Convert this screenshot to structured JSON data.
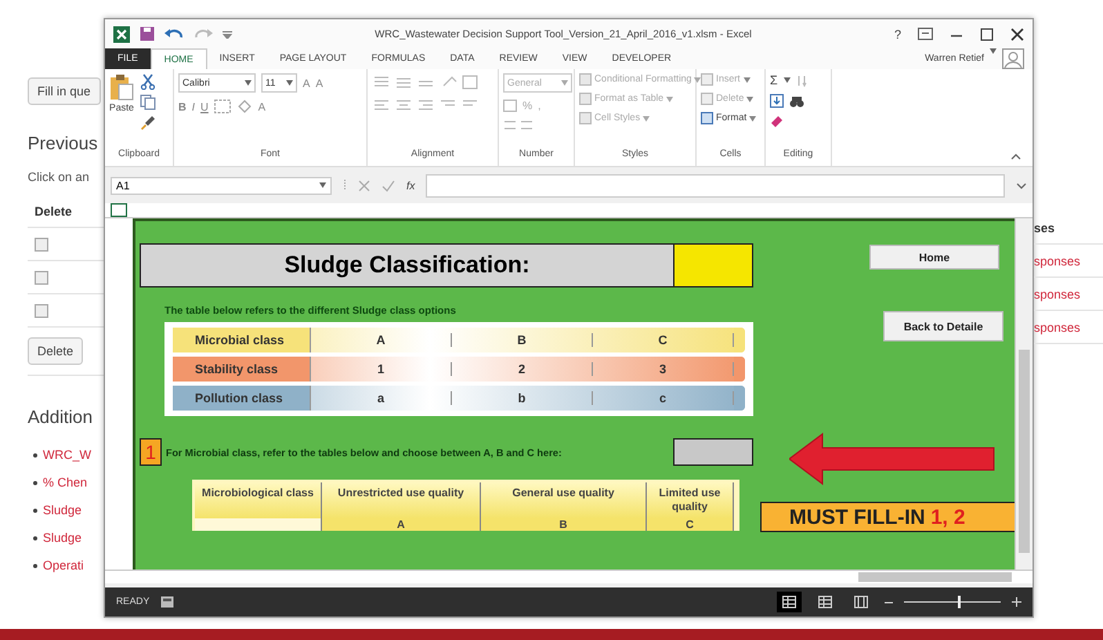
{
  "background_page": {
    "left": {
      "button": "Fill in que",
      "heading": "Previous",
      "instruction": "Click on an",
      "table_header": "Delete",
      "checkboxes": [
        {
          "checked": false
        },
        {
          "checked": false
        },
        {
          "checked": false
        }
      ],
      "delete_button": "Delete",
      "heading_2": "Addition",
      "links": [
        "WRC_W",
        "% Chen",
        "Sludge",
        "Sludge",
        "Operati"
      ]
    },
    "right": {
      "header": "ses",
      "links": [
        "sponses",
        "sponses",
        "sponses"
      ]
    }
  },
  "window": {
    "title": "WRC_Wastewater Decision Support Tool_Version_21_April_2016_v1.xlsm - Excel",
    "help": "?",
    "user": "Warren Retief"
  },
  "ribbon_tabs": [
    {
      "label": "FILE",
      "kind": "file",
      "selected": false
    },
    {
      "label": "HOME",
      "kind": "tab",
      "selected": true
    },
    {
      "label": "INSERT",
      "kind": "tab",
      "selected": false
    },
    {
      "label": "PAGE LAYOUT",
      "kind": "tab",
      "selected": false
    },
    {
      "label": "FORMULAS",
      "kind": "tab",
      "selected": false
    },
    {
      "label": "DATA",
      "kind": "tab",
      "selected": false
    },
    {
      "label": "REVIEW",
      "kind": "tab",
      "selected": false
    },
    {
      "label": "VIEW",
      "kind": "tab",
      "selected": false
    },
    {
      "label": "DEVELOPER",
      "kind": "tab",
      "selected": false
    }
  ],
  "ribbon": {
    "paste": "Paste",
    "font_name": "Calibri",
    "font_size": "11",
    "grow_buttons": [
      "A",
      "A"
    ],
    "format_buttons": [
      "B",
      "I",
      "U"
    ],
    "font_color": "A",
    "number_format": "General",
    "number_buttons": [
      "%",
      ","
    ],
    "styles": [
      "Conditional Formatting",
      "Format as Table",
      "Cell Styles"
    ],
    "cells": [
      "Insert",
      "Delete",
      "Format"
    ],
    "sum": "Σ",
    "groups": [
      "Clipboard",
      "Font",
      "Alignment",
      "Number",
      "Styles",
      "Cells",
      "Editing"
    ]
  },
  "formula_bar": {
    "name_box": "A1",
    "function_label": "fx"
  },
  "sheet": {
    "title": "Sludge Classification:",
    "subtitle": "The table below refers to the different Sludge class options",
    "class_rows": [
      {
        "label": "Microbial class",
        "values": [
          "A",
          "B",
          "C"
        ],
        "color": "#f6e27a"
      },
      {
        "label": "Stability class",
        "values": [
          "1",
          "2",
          "3"
        ],
        "color": "#f2966b"
      },
      {
        "label": "Pollution class",
        "values": [
          "a",
          "b",
          "c"
        ],
        "color": "#8fb1c8"
      }
    ],
    "step": {
      "number": "1",
      "text": "For Microbial class, refer to the tables below and choose between A, B and C here:"
    },
    "micro_table": {
      "columns": [
        "Microbiological class",
        "Unrestricted use quality",
        "General use quality",
        "Limited use quality"
      ],
      "row": [
        "A",
        "B",
        "C"
      ]
    },
    "buttons": [
      "Home",
      "Back to Detaile"
    ],
    "banner": {
      "text": "MUST FILL-IN",
      "highlight": "1, 2"
    }
  },
  "status_bar": {
    "status": "READY",
    "views": [
      {
        "selected": true
      },
      {
        "selected": false
      },
      {
        "selected": false
      }
    ],
    "zoom": {
      "level": 0.55
    }
  }
}
